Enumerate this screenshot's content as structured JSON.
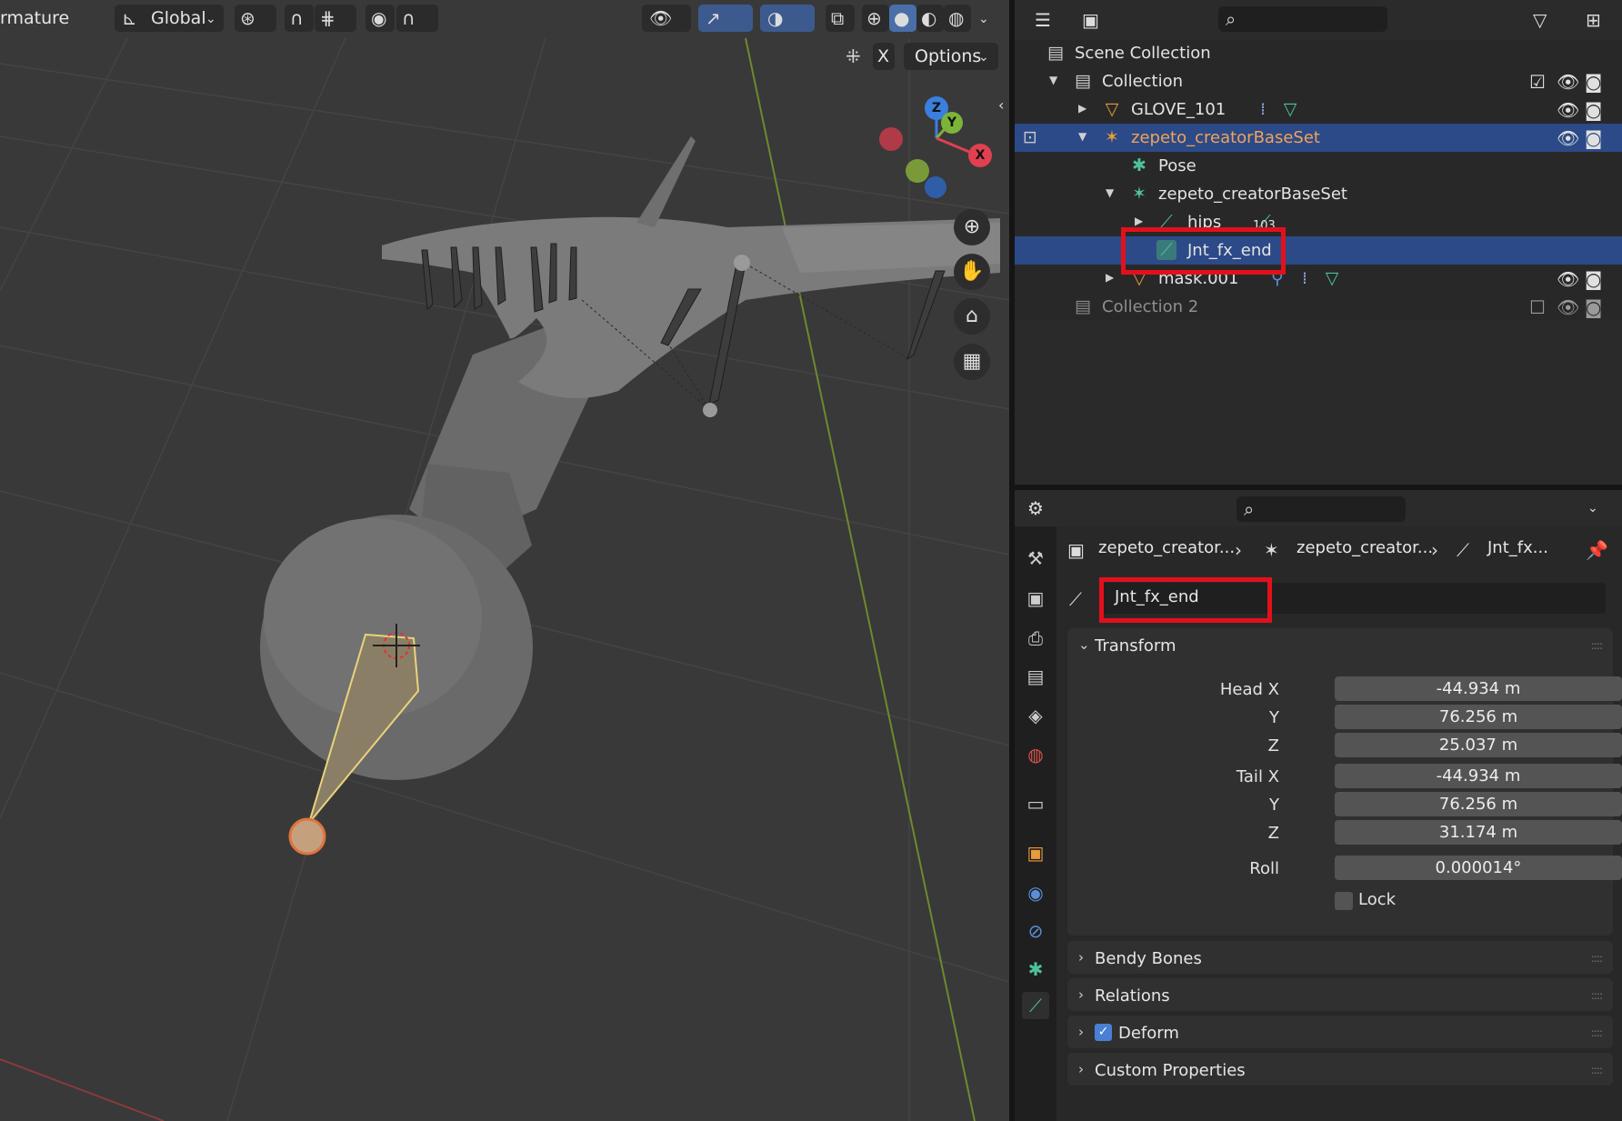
{
  "viewport": {
    "mode_label": "rmature",
    "orientation_label": "Global",
    "options_label": "Options",
    "x_label": "X",
    "gizmo": {
      "z": "Z",
      "y": "Y",
      "x": "X"
    }
  },
  "outliner": {
    "rows": [
      {
        "label": "Scene Collection",
        "icon": "scene-collection-icon"
      },
      {
        "label": "Collection",
        "icon": "collection-icon"
      },
      {
        "label": "GLOVE_101",
        "icon": "mesh-object-icon"
      },
      {
        "label": "zepeto_creatorBaseSet",
        "icon": "armature-object-icon"
      },
      {
        "label": "Pose",
        "icon": "pose-icon"
      },
      {
        "label": "zepeto_creatorBaseSet",
        "icon": "armature-data-icon"
      },
      {
        "label": "hips",
        "icon": "bone-icon",
        "badge": "103"
      },
      {
        "label": "Jnt_fx_end",
        "icon": "bone-icon"
      },
      {
        "label": "mask.001",
        "icon": "mesh-object-icon"
      },
      {
        "label": "Collection 2",
        "icon": "collection-icon"
      }
    ]
  },
  "properties": {
    "breadcrumb": [
      "zepeto_creator...",
      "zepeto_creator...",
      "Jnt_fx..."
    ],
    "bone_name": "Jnt_fx_end",
    "transform": {
      "title": "Transform",
      "head_x_label": "Head X",
      "head_x": "-44.934 m",
      "head_y_label": "Y",
      "head_y": "76.256 m",
      "head_z_label": "Z",
      "head_z": "25.037 m",
      "tail_x_label": "Tail X",
      "tail_x": "-44.934 m",
      "tail_y_label": "Y",
      "tail_y": "76.256 m",
      "tail_z_label": "Z",
      "tail_z": "31.174 m",
      "roll_label": "Roll",
      "roll": "0.000014°",
      "lock_label": "Lock"
    },
    "panels": [
      "Bendy Bones",
      "Relations",
      "Deform",
      "Custom Properties"
    ]
  },
  "colors": {
    "selection": "#2c4a87",
    "highlight_box": "#e3101c",
    "bone_green": "#4ec29a",
    "mesh_orange": "#e89b3c"
  }
}
